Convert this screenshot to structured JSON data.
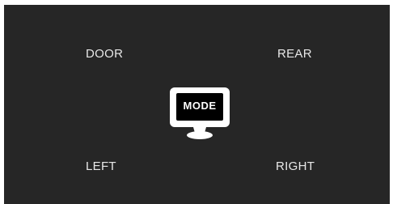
{
  "zones": {
    "door": "DOOR",
    "rear": "REAR",
    "left": "LEFT",
    "right": "RIGHT"
  },
  "mode_button": {
    "label": "MODE",
    "icon": "monitor-icon"
  },
  "colors": {
    "background": "#262626",
    "text": "#e8e8e8",
    "icon": "#ffffff"
  }
}
